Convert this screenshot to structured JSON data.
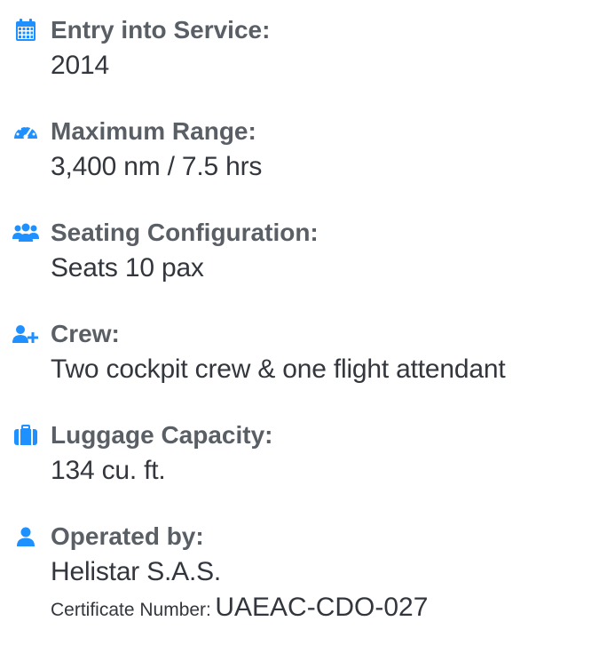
{
  "accent_color": "#1e90ff",
  "specs": [
    {
      "icon": "calendar-icon",
      "label": "Entry into Service:",
      "value": "2014"
    },
    {
      "icon": "speedometer-icon",
      "label": "Maximum Range:",
      "value": "3,400 nm / 7.5 hrs"
    },
    {
      "icon": "users-icon",
      "label": "Seating Configuration:",
      "value": "Seats 10 pax"
    },
    {
      "icon": "user-plus-icon",
      "label": "Crew:",
      "value": "Two cockpit crew & one flight attendant"
    },
    {
      "icon": "suitcase-icon",
      "label": "Luggage Capacity:",
      "value": "134 cu. ft."
    },
    {
      "icon": "user-icon",
      "label": "Operated by:",
      "value": "Helistar S.A.S.",
      "certificate_label": "Certificate Number:",
      "certificate_value": "UAEAC-CDO-027"
    }
  ]
}
